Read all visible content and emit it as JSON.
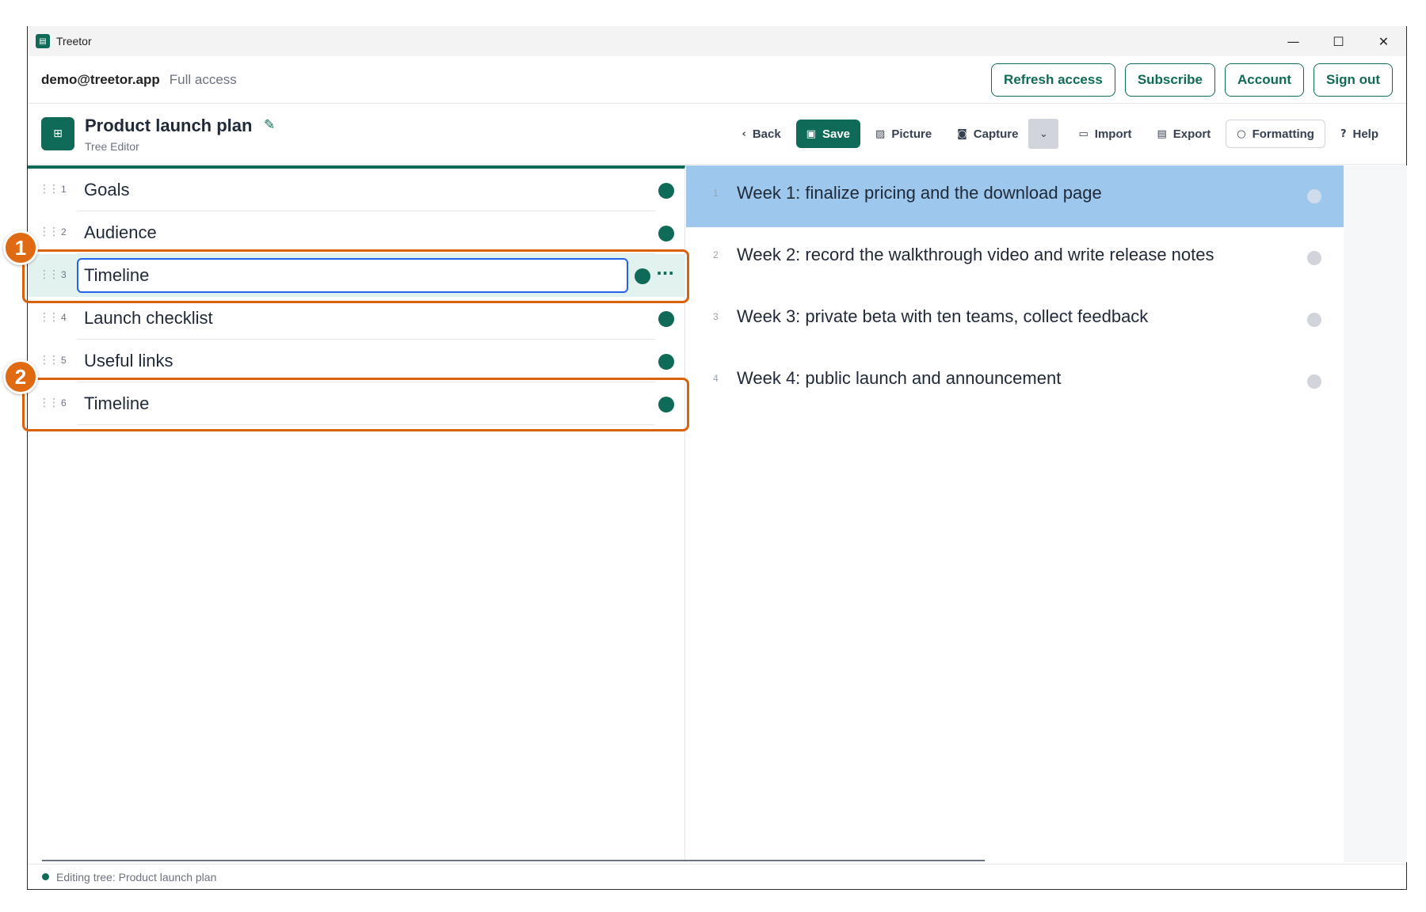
{
  "window": {
    "title": "Treetor",
    "controls": {
      "minimize": "—",
      "maximize": "☐",
      "close": "✕"
    }
  },
  "account": {
    "email": "demo@treetor.app",
    "access": "Full access",
    "buttons": [
      "Refresh access",
      "Subscribe",
      "Account",
      "Sign out"
    ]
  },
  "document": {
    "title": "Product launch plan",
    "subtitle": "Tree Editor"
  },
  "toolbar": {
    "back": "Back",
    "save": "Save",
    "picture": "Picture",
    "capture": "Capture",
    "import": "Import",
    "export": "Export",
    "formatting": "Formatting",
    "help": "Help"
  },
  "tree": {
    "items": [
      {
        "num": "1",
        "label": "Goals"
      },
      {
        "num": "2",
        "label": "Audience"
      },
      {
        "num": "3",
        "label": "Timeline"
      },
      {
        "num": "4",
        "label": "Launch checklist"
      },
      {
        "num": "5",
        "label": "Useful links"
      },
      {
        "num": "6",
        "label": "Timeline"
      }
    ]
  },
  "detail": {
    "items": [
      {
        "num": "1",
        "label": "Week 1: finalize pricing and the download page"
      },
      {
        "num": "2",
        "label": "Week 2: record the walkthrough video and write release notes"
      },
      {
        "num": "3",
        "label": "Week 3: private beta with ten teams, collect feedback"
      },
      {
        "num": "4",
        "label": "Week 4: public launch and announcement"
      }
    ]
  },
  "status": {
    "text": "Editing tree: Product launch plan"
  },
  "callouts": [
    "1",
    "2"
  ],
  "colors": {
    "brand": "#0f6b58",
    "callout": "#e06a12",
    "active_row": "#9dc7ec"
  }
}
